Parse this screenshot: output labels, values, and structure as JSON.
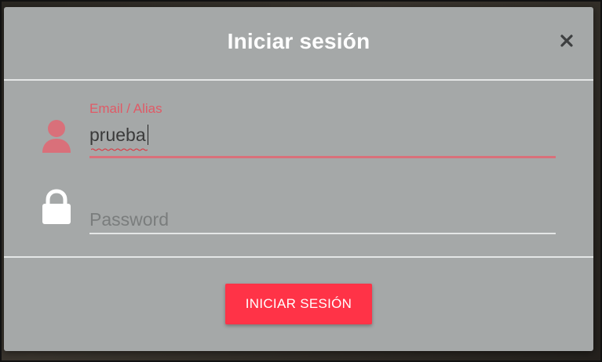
{
  "dialog": {
    "title": "Iniciar sesión",
    "close_icon": "close-icon"
  },
  "email_field": {
    "label": "Email / Alias",
    "value": "prueba",
    "icon": "user-icon",
    "accent_color": "#e05a66",
    "spellcheck_error": true
  },
  "password_field": {
    "placeholder": "Password",
    "value": "",
    "icon": "lock-icon"
  },
  "submit": {
    "label": "INICIAR SESIÓN",
    "color": "#ff3347"
  },
  "colors": {
    "modal_background": "#a5a8a8",
    "divider": "#e4e6e6",
    "title": "#ffffff"
  }
}
